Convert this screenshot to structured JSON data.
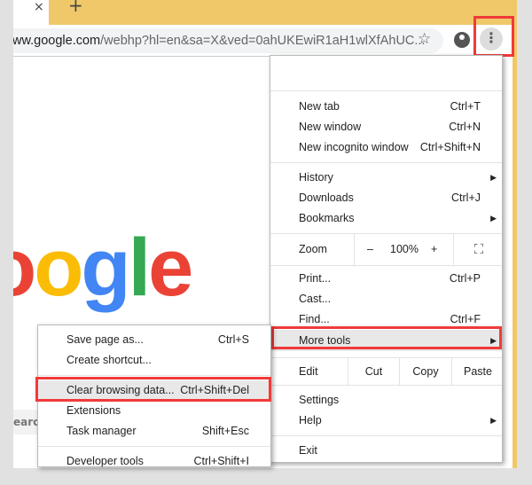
{
  "tab": {
    "close": "×",
    "new_tab": "+"
  },
  "omnibox": {
    "url_host": "ww.google.com",
    "url_path": "/webhp?hl=en&sa=X&ved=0ahUKEwiR1aH1wlXfAhUC..."
  },
  "icons": {
    "bookmark": "star-icon",
    "account": "account-icon",
    "menu": "kebab-menu-icon"
  },
  "page": {
    "logo": "oogle",
    "search_fragment": "earc"
  },
  "menu": {
    "group1": [
      {
        "label": "New tab",
        "shortcut": "Ctrl+T"
      },
      {
        "label": "New window",
        "shortcut": "Ctrl+N"
      },
      {
        "label": "New incognito window",
        "shortcut": "Ctrl+Shift+N"
      }
    ],
    "group2": [
      {
        "label": "History"
      },
      {
        "label": "Downloads",
        "shortcut": "Ctrl+J"
      },
      {
        "label": "Bookmarks"
      }
    ],
    "zoom": {
      "label": "Zoom",
      "minus": "–",
      "value": "100%",
      "plus": "+"
    },
    "group3": [
      {
        "label": "Print...",
        "shortcut": "Ctrl+P"
      },
      {
        "label": "Cast..."
      },
      {
        "label": "Find...",
        "shortcut": "Ctrl+F"
      },
      {
        "label": "More tools"
      }
    ],
    "edit": {
      "label": "Edit",
      "cut": "Cut",
      "copy": "Copy",
      "paste": "Paste"
    },
    "group4": [
      {
        "label": "Settings"
      },
      {
        "label": "Help"
      }
    ],
    "exit": "Exit"
  },
  "submenu": {
    "items": [
      {
        "label": "Save page as...",
        "shortcut": "Ctrl+S"
      },
      {
        "label": "Create shortcut..."
      },
      {
        "label": "Clear browsing data...",
        "shortcut": "Ctrl+Shift+Del"
      },
      {
        "label": "Extensions"
      },
      {
        "label": "Task manager",
        "shortcut": "Shift+Esc"
      },
      {
        "label": "Developer tools",
        "shortcut": "Ctrl+Shift+I"
      }
    ]
  },
  "colors": {
    "highlight_border": "#f03a3a",
    "tab_bar": "#f0c869"
  }
}
